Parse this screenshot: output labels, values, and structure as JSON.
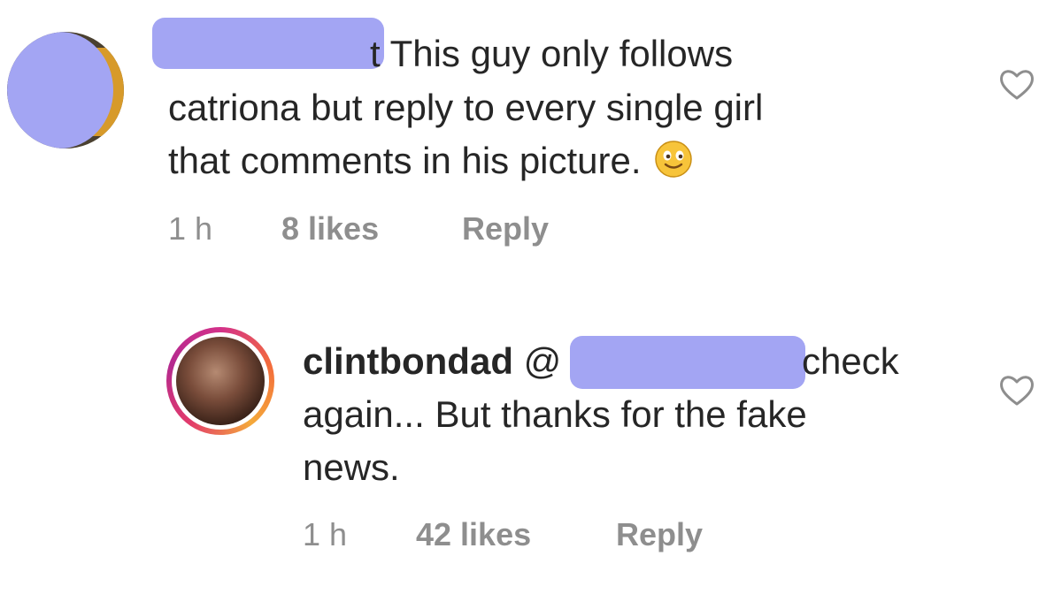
{
  "comments": [
    {
      "text_line1": "t This guy only follows",
      "text_line2": "catriona but reply to every single girl",
      "text_line3": "that comments in his picture.",
      "time": "1 h",
      "likes": "8 likes",
      "reply": "Reply",
      "emoji": "smiling-face-emoji"
    },
    {
      "username": "clintbondad",
      "mention_prefix": "@",
      "text_line1_tail": "check",
      "text_line2": "again... But thanks for the fake",
      "text_line3": "news.",
      "time": "1 h",
      "likes": "42 likes",
      "reply": "Reply"
    }
  ],
  "colors": {
    "redaction": "#a3a5f3",
    "text": "#262626",
    "meta": "#8e8e8e",
    "story_ring": "#d3318a"
  },
  "icons": [
    "heart-outline-icon"
  ]
}
